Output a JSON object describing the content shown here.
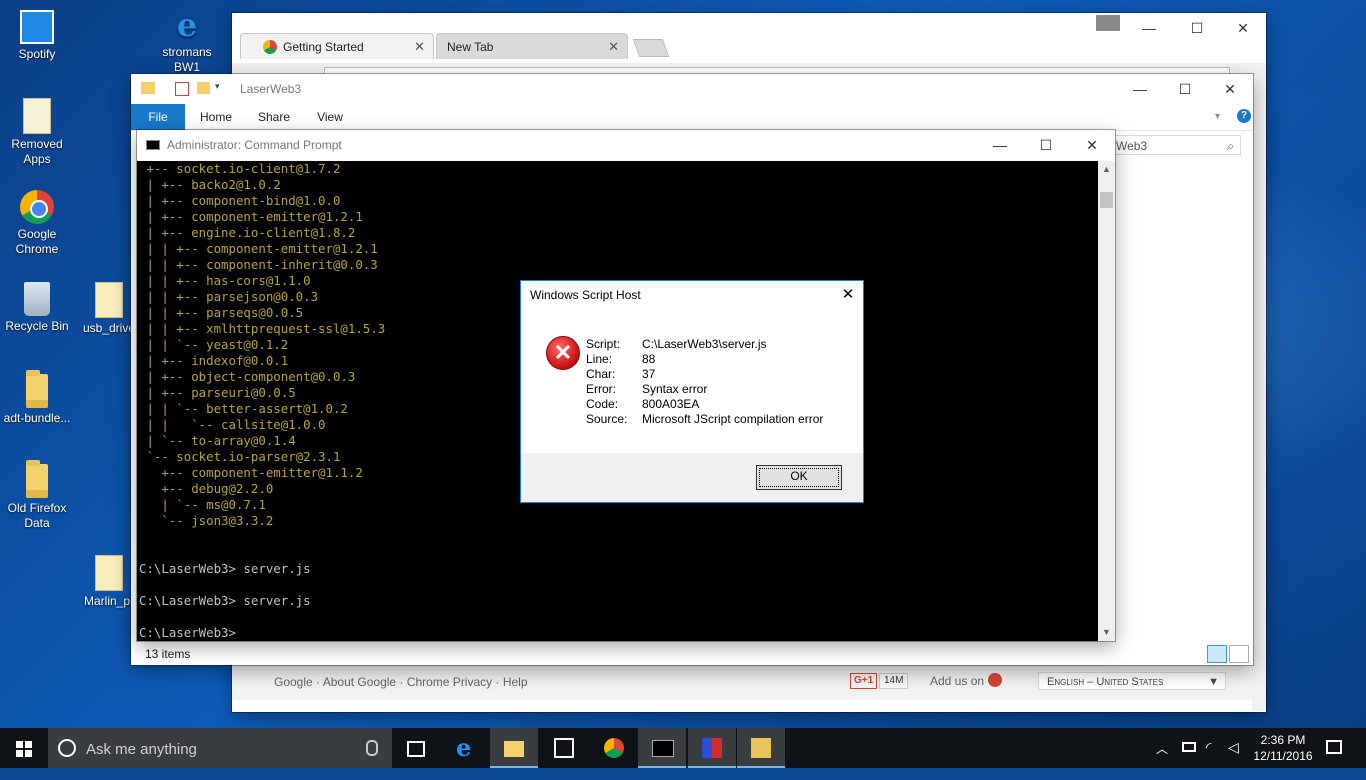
{
  "desktop": {
    "icons": [
      {
        "label": "Spotify"
      },
      {
        "label": "stromans BW1"
      },
      {
        "label": "Removed Apps"
      },
      {
        "label": "Google Chrome"
      },
      {
        "label": "Recycle Bin"
      },
      {
        "label": "usb_drive"
      },
      {
        "label": "adt-bundle..."
      },
      {
        "label": "Old Firefox Data"
      },
      {
        "label": "Marlin_pr"
      }
    ]
  },
  "chrome": {
    "tabs": [
      {
        "label": "Getting Started"
      },
      {
        "label": "New Tab"
      }
    ],
    "footer": {
      "links": [
        "Google",
        "About Google",
        "Chrome Privacy",
        "Help"
      ],
      "separator": "·",
      "gplus": "G+1",
      "gplus_count": "14M",
      "add_us": "Add us on",
      "language": "English – United States"
    }
  },
  "explorer": {
    "title": "LaserWeb3",
    "ribbon_tabs": [
      "File",
      "Home",
      "Share",
      "View"
    ],
    "search_value": "Web3",
    "status": "13 items"
  },
  "cmd": {
    "title": "Administrator: Command Prompt",
    "tree_lines": [
      " +-- socket.io-client@1.7.2",
      " | +-- backo2@1.0.2",
      " | +-- component-bind@1.0.0",
      " | +-- component-emitter@1.2.1",
      " | +-- engine.io-client@1.8.2",
      " | | +-- component-emitter@1.2.1",
      " | | +-- component-inherit@0.0.3",
      " | | +-- has-cors@1.1.0",
      " | | +-- parsejson@0.0.3",
      " | | +-- parseqs@0.0.5",
      " | | +-- xmlhttprequest-ssl@1.5.3",
      " | | `-- yeast@0.1.2",
      " | +-- indexof@0.0.1",
      " | +-- object-component@0.0.3",
      " | +-- parseuri@0.0.5",
      " | | `-- better-assert@1.0.2",
      " | |   `-- callsite@1.0.0",
      " | `-- to-array@0.1.4",
      " `-- socket.io-parser@2.3.1",
      "   +-- component-emitter@1.1.2",
      "   +-- debug@2.2.0",
      "   | `-- ms@0.7.1",
      "   `-- json3@3.3.2"
    ],
    "prompt_lines": [
      "",
      "",
      "C:\\LaserWeb3> server.js",
      "",
      "C:\\LaserWeb3> server.js",
      "",
      "C:\\LaserWeb3>"
    ]
  },
  "dialog": {
    "title": "Windows Script Host",
    "fields": [
      {
        "key": "Script:",
        "value": "C:\\LaserWeb3\\server.js"
      },
      {
        "key": "Line:",
        "value": "88"
      },
      {
        "key": "Char:",
        "value": "37"
      },
      {
        "key": "Error:",
        "value": "Syntax error"
      },
      {
        "key": "Code:",
        "value": "800A03EA"
      },
      {
        "key": "Source:",
        "value": "Microsoft JScript compilation error"
      }
    ],
    "ok_label": "OK"
  },
  "taskbar": {
    "search_placeholder": "Ask me anything",
    "time": "2:36 PM",
    "date": "12/11/2016"
  }
}
